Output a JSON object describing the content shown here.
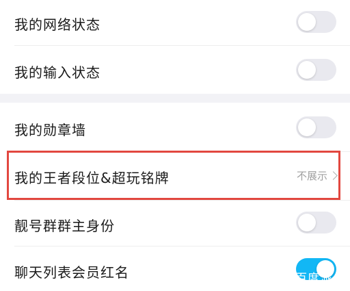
{
  "settings": {
    "network_status": {
      "label": "我的网络状态",
      "enabled": false
    },
    "input_status": {
      "label": "我的输入状态",
      "enabled": false
    },
    "medal_wall": {
      "label": "我的勋章墙",
      "enabled": false
    },
    "king_rank": {
      "label": "我的王者段位&超玩铭牌",
      "detail": "不展示"
    },
    "group_owner": {
      "label": "靓号群群主身份",
      "enabled": false
    },
    "vip_red_name": {
      "label": "聊天列表会员红名",
      "enabled": true
    }
  },
  "watermark": {
    "text": "百度派"
  },
  "colors": {
    "toggle_on": "#12b7f5",
    "toggle_off": "#e9e9ef",
    "highlight_border": "#e2473f",
    "section_gap": "#f2f2f6"
  },
  "icons": {
    "detail_arrow": "chevron-right-icon"
  }
}
